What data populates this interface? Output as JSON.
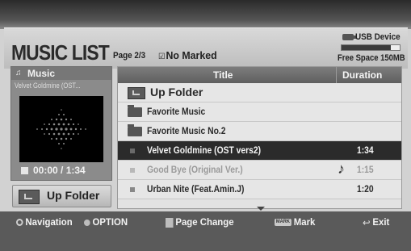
{
  "header": {
    "title": "MUSIC LIST",
    "page_indicator": "Page 2/3",
    "marked_status": "No Marked",
    "usb_label": "USB Device",
    "free_space": "Free Space 150MB",
    "storage_used_fraction": 0.85
  },
  "preview": {
    "title": "Music",
    "track": "Velvet Goldmine (OST...",
    "time": "00:00 / 1:34"
  },
  "left_button": {
    "label": "Up Folder"
  },
  "list": {
    "col_title": "Title",
    "col_duration": "Duration",
    "rows": [
      {
        "label": "Up Folder",
        "duration": "",
        "kind": "up"
      },
      {
        "label": "Favorite Music",
        "duration": "",
        "kind": "folder"
      },
      {
        "label": "Favorite Music No.2",
        "duration": "",
        "kind": "folder"
      },
      {
        "label": "Velvet Goldmine (OST vers2)",
        "duration": "1:34",
        "kind": "file-selected"
      },
      {
        "label": "Good Bye (Original Ver.)",
        "duration": "1:15",
        "kind": "file-dim-playing"
      },
      {
        "label": "Urban Nite (Feat.Amin.J)",
        "duration": "1:20",
        "kind": "file"
      }
    ]
  },
  "footer": {
    "navigation": "Navigation",
    "option": "OPTION",
    "page_change": "Page Change",
    "mark_key": "MARK",
    "mark": "Mark",
    "exit": "Exit"
  },
  "icons": {
    "usb": "usb-icon",
    "folder": "folder-icon",
    "up_folder": "up-folder-icon",
    "music_note": "music-note-icon"
  }
}
